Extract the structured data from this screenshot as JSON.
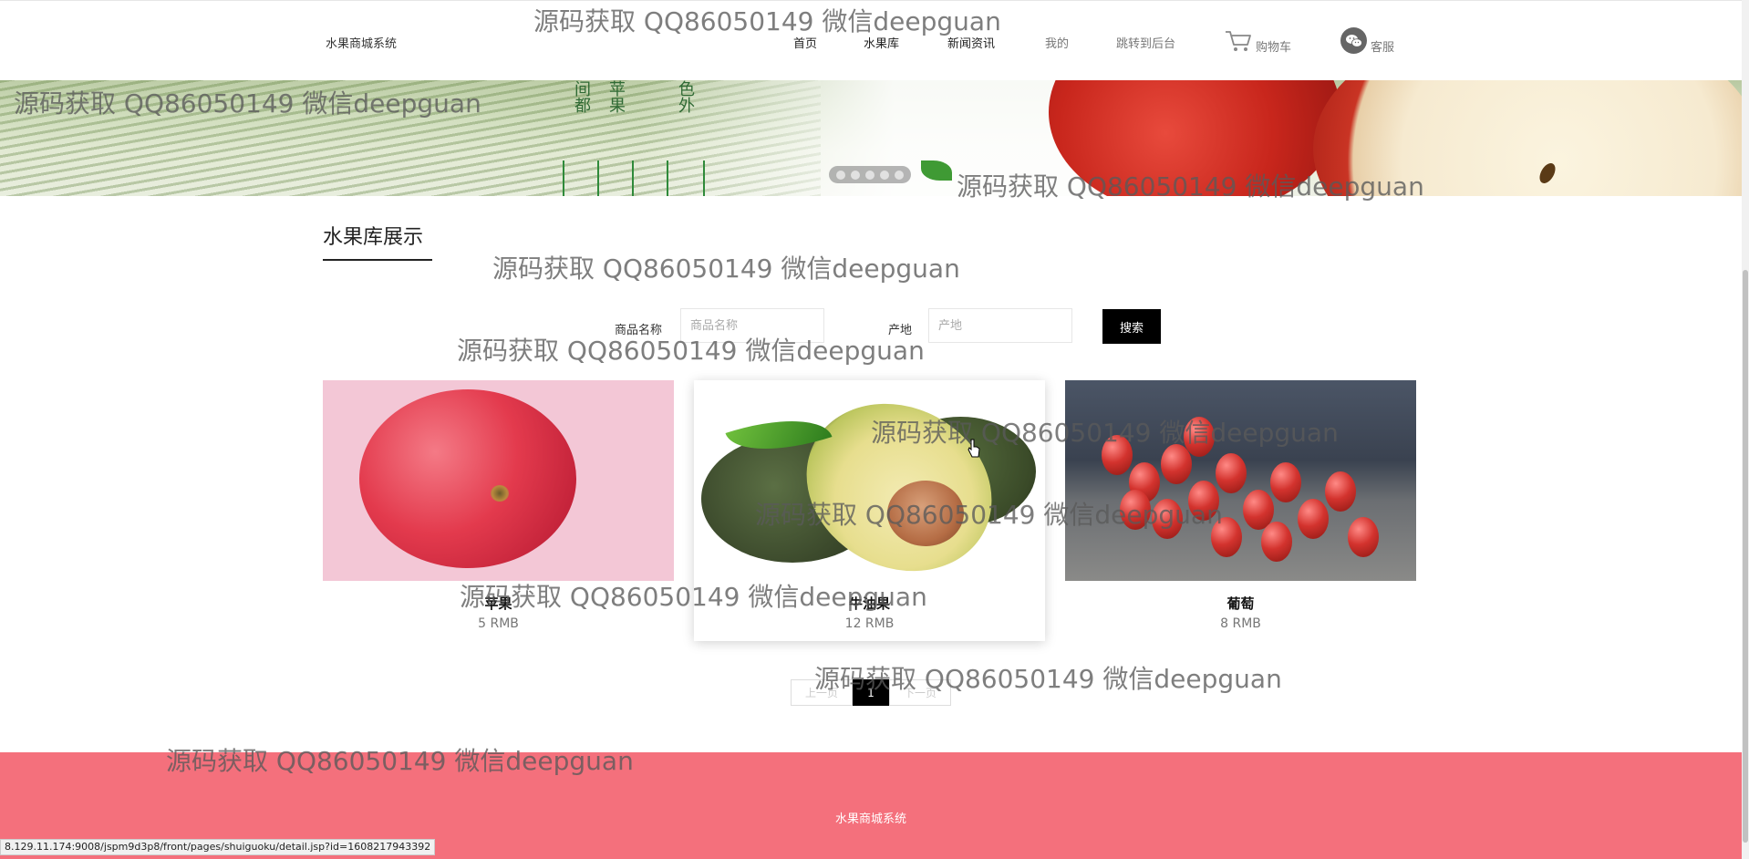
{
  "header": {
    "site_name": "水果商城系统",
    "nav": {
      "home": "首页",
      "fruit_library": "水果库",
      "news": "新闻资讯",
      "mine": "我的",
      "admin": "跳转到后台",
      "cart": "购物车",
      "service": "客服"
    }
  },
  "banner": {
    "chars_col1": "间都",
    "chars_col2": "苹果",
    "chars_col3": "色外",
    "dots_count": 5
  },
  "section": {
    "title": "水果库展示"
  },
  "search": {
    "name_label": "商品名称",
    "name_placeholder": "商品名称",
    "origin_label": "产地",
    "origin_placeholder": "产地",
    "button": "搜索"
  },
  "products": [
    {
      "name": "苹果",
      "price": "5 RMB"
    },
    {
      "name": "牛油果",
      "price": "12 RMB"
    },
    {
      "name": "葡萄",
      "price": "8 RMB"
    }
  ],
  "pagination": {
    "prev": "上一页",
    "current": "1",
    "next": "下一页"
  },
  "footer": {
    "text": "水果商城系统"
  },
  "status_url": "8.129.11.174:9008/jspm9d3p8/front/pages/shuiguoku/detail.jsp?id=1608217943392",
  "watermark": "源码获取 QQ86050149 微信deepguan",
  "colors": {
    "footer_bg": "#f4707c",
    "button_bg": "#000000"
  }
}
